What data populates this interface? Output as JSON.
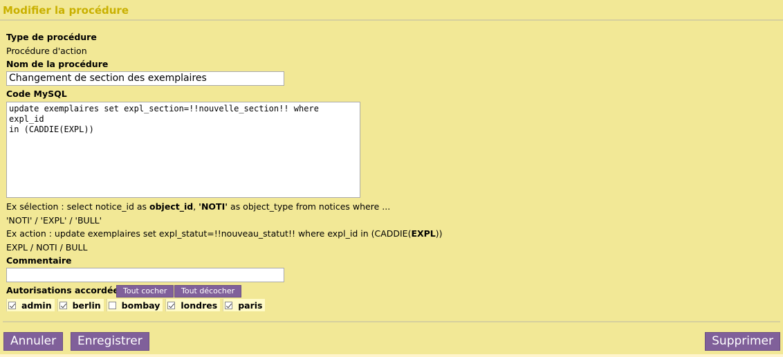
{
  "page": {
    "title": "Modifier la procédure"
  },
  "form": {
    "type_label": "Type de procédure",
    "type_value": "Procédure d'action",
    "name_label": "Nom de la procédure",
    "name_value": "Changement de section des exemplaires",
    "code_label": "Code MySQL",
    "code_value": "update exemplaires set expl_section=!!nouvelle_section!! where expl_id\nin (CADDIE(EXPL))",
    "hint_selection_prefix": "Ex sélection : select notice_id as ",
    "hint_selection_b1": "object_id",
    "hint_selection_mid": ", ",
    "hint_selection_b2": "'NOTI'",
    "hint_selection_suffix": " as object_type from notices where ...",
    "hint_types": "'NOTI' / 'EXPL' / 'BULL'",
    "hint_action_prefix": "Ex action : update exemplaires set expl_statut=!!nouveau_statut!! where expl_id in (CADDIE(",
    "hint_action_b": "EXPL",
    "hint_action_suffix": "))",
    "hint_objects": "EXPL / NOTI / BULL",
    "comment_label": "Commentaire",
    "comment_value": "",
    "auth_label": "Autorisations accordées",
    "check_all": "Tout cocher",
    "uncheck_all": "Tout décocher",
    "users": [
      {
        "name": "admin",
        "checked": true
      },
      {
        "name": "berlin",
        "checked": true
      },
      {
        "name": "bombay",
        "checked": false
      },
      {
        "name": "londres",
        "checked": true
      },
      {
        "name": "paris",
        "checked": true
      }
    ]
  },
  "actions": {
    "cancel": "Annuler",
    "save": "Enregistrer",
    "delete": "Supprimer"
  },
  "colors": {
    "background": "#f2e896",
    "title": "#c9b000",
    "button": "#80609a"
  }
}
